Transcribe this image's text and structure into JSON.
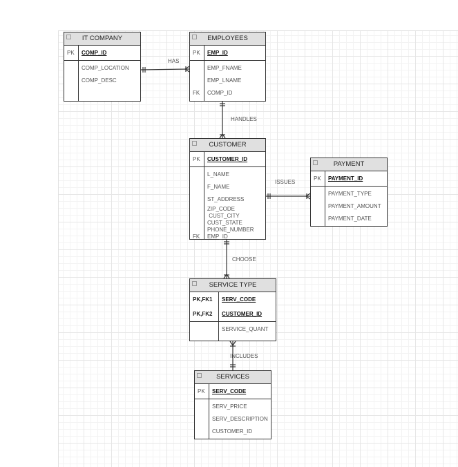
{
  "entities": {
    "it_company": {
      "title": "IT COMPANY",
      "pk": [
        {
          "key": "PK",
          "field": "COMP_ID"
        }
      ],
      "attrs": [
        {
          "key": "",
          "field": "COMP_LOCATION"
        },
        {
          "key": "",
          "field": "COMP_DESC"
        }
      ]
    },
    "employees": {
      "title": "EMPLOYEES",
      "pk": [
        {
          "key": "PK",
          "field": "EMP_ID"
        }
      ],
      "attrs": [
        {
          "key": "",
          "field": "EMP_FNAME"
        },
        {
          "key": "",
          "field": "EMP_LNAME"
        },
        {
          "key": "FK",
          "field": "COMP_ID"
        }
      ]
    },
    "customer": {
      "title": "CUSTOMER",
      "pk": [
        {
          "key": "PK",
          "field": "CUSTOMER_ID"
        }
      ],
      "attrs": [
        {
          "key": "",
          "field": "L_NAME"
        },
        {
          "key": "",
          "field": "F_NAME"
        },
        {
          "key": "",
          "field": "ST_ADDRESS"
        },
        {
          "key": "",
          "field": "ZIP_CODE"
        },
        {
          "key": "",
          "field": " CUST_CITY"
        },
        {
          "key": "",
          "field": "CUST_STATE"
        },
        {
          "key": "",
          "field": "PHONE_NUMBER"
        },
        {
          "key": "FK",
          "field": "EMP_ID"
        }
      ]
    },
    "payment": {
      "title": "PAYMENT",
      "pk": [
        {
          "key": "PK",
          "field": "PAYMENT_ID"
        }
      ],
      "attrs": [
        {
          "key": "",
          "field": "PAYMENT_TYPE"
        },
        {
          "key": "",
          "field": "PAYMENT_AMOUNT"
        },
        {
          "key": "",
          "field": "PAYMENT_DATE"
        }
      ]
    },
    "service_type": {
      "title": "SERVICE TYPE",
      "pk": [
        {
          "key": "PK,FK1",
          "field": "SERV_CODE"
        },
        {
          "key": "PK,FK2",
          "field": "CUSTOMER_ID"
        }
      ],
      "attrs": [
        {
          "key": "",
          "field": "SERVICE_QUANT"
        }
      ]
    },
    "services": {
      "title": "SERVICES",
      "pk": [
        {
          "key": "PK",
          "field": "SERV_CODE"
        }
      ],
      "attrs": [
        {
          "key": "",
          "field": "SERV_PRICE"
        },
        {
          "key": "",
          "field": "SERV_DESCRIPTION"
        },
        {
          "key": "",
          "field": "CUSTOMER_ID"
        }
      ]
    }
  },
  "relationships": {
    "has": "HAS",
    "handles": "HANDLES",
    "issues": "ISSUES",
    "choose": "CHOOSE",
    "includes": "INCLUDES"
  }
}
